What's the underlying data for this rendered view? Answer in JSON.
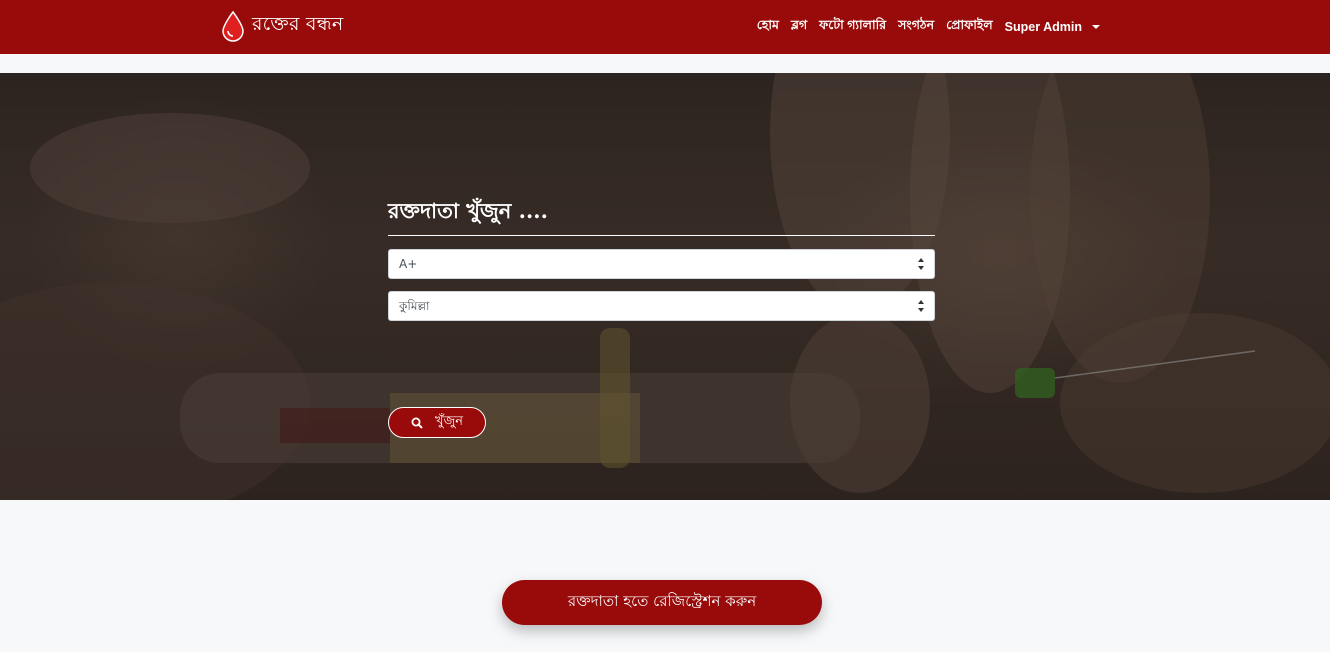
{
  "brand": {
    "name": "রক্তের বন্ধন",
    "icon": "blood-drop-icon"
  },
  "nav": {
    "items": [
      {
        "label": "হোম"
      },
      {
        "label": "ব্লগ"
      },
      {
        "label": "ফটো গ্যালারি"
      },
      {
        "label": "সংগঠন"
      },
      {
        "label": "প্রোফাইল"
      }
    ],
    "user_menu": {
      "label": "Super Admin"
    }
  },
  "search": {
    "title": "রক্তদাতা খুঁজুন ....",
    "blood_group": {
      "selected": "A+"
    },
    "district": {
      "selected": "কুমিল্লা"
    },
    "button_label": "খুঁজুন",
    "button_icon": "search-icon"
  },
  "register": {
    "button_label": "রক্তদাতা হতে রেজিস্ট্রেশন করুন"
  },
  "colors": {
    "primary": "#990a0a",
    "page_background": "#f7f8fa"
  }
}
